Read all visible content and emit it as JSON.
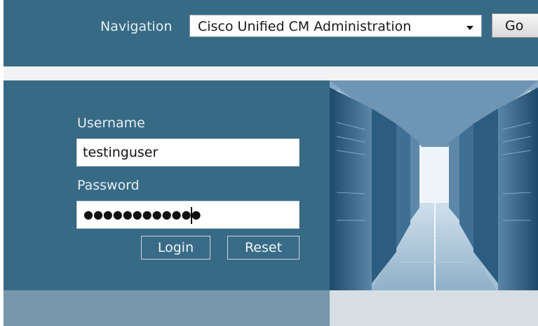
{
  "header": {
    "navigation_label": "Navigation",
    "navigation_selected": "Cisco Unified CM Administration",
    "go_label": "Go"
  },
  "login": {
    "username_label": "Username",
    "username_value": "testinguser",
    "password_label": "Password",
    "password_mask": "●●●●●●●●●●●●",
    "login_label": "Login",
    "reset_label": "Reset"
  },
  "colors": {
    "panel": "#376a85",
    "footer_left": "#7797aa",
    "footer_right": "#d6dee3"
  }
}
